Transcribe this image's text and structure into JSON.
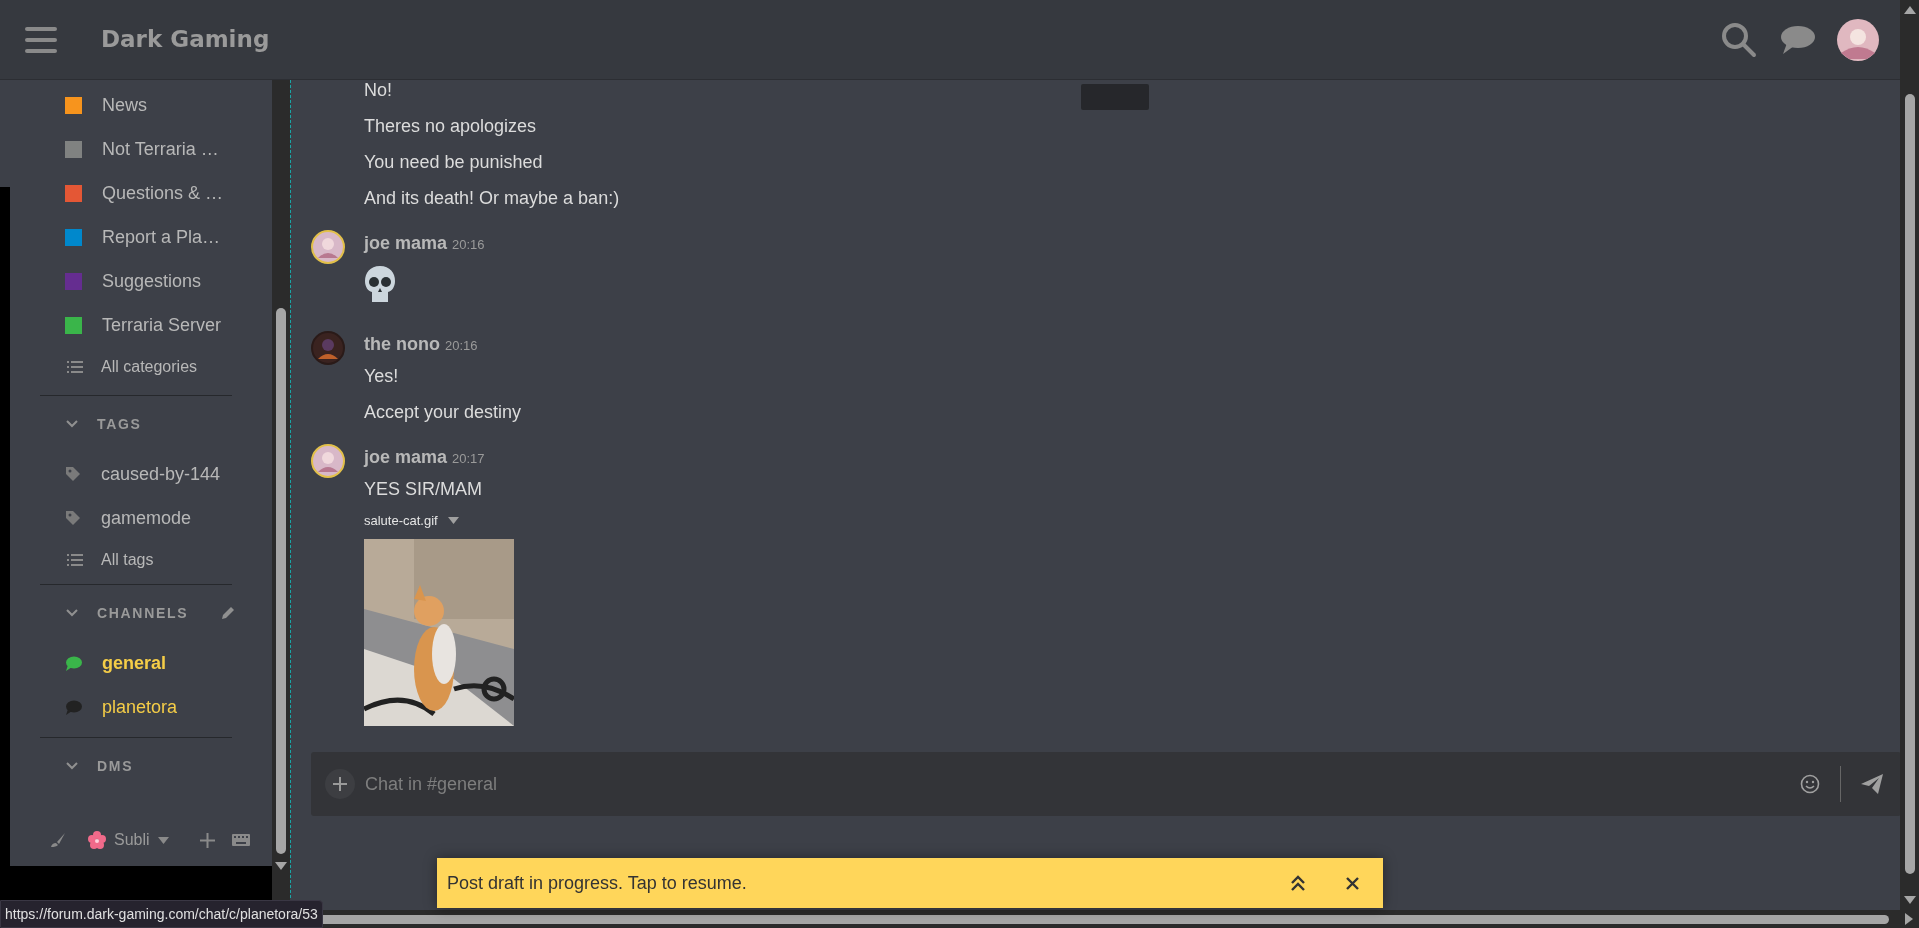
{
  "header": {
    "title": "Dark Gaming"
  },
  "sidebar": {
    "categories": [
      {
        "label": "News",
        "color": "#f7941d"
      },
      {
        "label": "Not Terraria …",
        "color": "#808281"
      },
      {
        "label": "Questions & …",
        "color": "#e45735"
      },
      {
        "label": "Report a Pla…",
        "color": "#0088cc"
      },
      {
        "label": "Suggestions",
        "color": "#652d90"
      },
      {
        "label": "Terraria Server",
        "color": "#3ab54a"
      }
    ],
    "all_categories": "All categories",
    "tags_heading": "TAGS",
    "tags": [
      "caused-by-144",
      "gamemode"
    ],
    "all_tags": "All tags",
    "channels_heading": "CHANNELS",
    "channels": [
      {
        "name": "general",
        "selected": true
      },
      {
        "name": "planetora",
        "selected": false
      }
    ],
    "dms_heading": "DMS",
    "status_name": "Subli"
  },
  "messages": [
    {
      "items": [
        {
          "kind": "text",
          "text": "No!"
        },
        {
          "kind": "text",
          "text": "Theres no apologizes"
        },
        {
          "kind": "text",
          "text": "You need be punished"
        },
        {
          "kind": "text",
          "text": "And its death! Or maybe a ban:)"
        }
      ]
    },
    {
      "author": "joe mama",
      "time": "20:16",
      "avatar_ring": true,
      "items": [
        {
          "kind": "emoji"
        }
      ]
    },
    {
      "author": "the nono",
      "time": "20:16",
      "avatar_ring": false,
      "items": [
        {
          "kind": "text",
          "text": "Yes!"
        },
        {
          "kind": "text",
          "text": "Accept your destiny"
        }
      ]
    },
    {
      "author": "joe mama",
      "time": "20:17",
      "avatar_ring": true,
      "items": [
        {
          "kind": "text",
          "text": "YES SIR/MAM"
        },
        {
          "filename": "salute-cat.gif"
        }
      ]
    }
  ],
  "composer": {
    "placeholder": "Chat in #general"
  },
  "draft_banner": {
    "text": "Post draft in progress. Tap to resume."
  },
  "status_url": "https://forum.dark-gaming.com/chat/c/planetora/53"
}
